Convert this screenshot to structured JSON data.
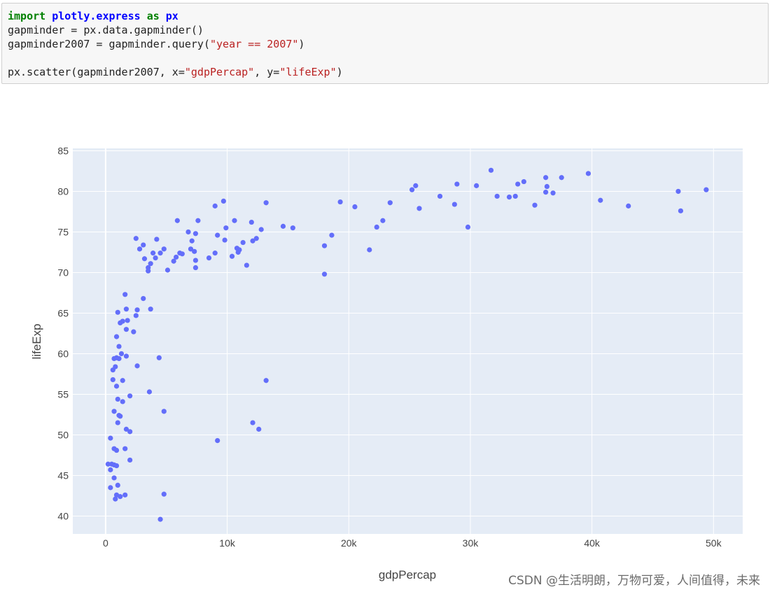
{
  "code_cell": {
    "lines": [
      [
        {
          "t": "import",
          "c": "kw"
        },
        {
          "t": " ",
          "c": ""
        },
        {
          "t": "plotly.express",
          "c": "mod"
        },
        {
          "t": " ",
          "c": ""
        },
        {
          "t": "as",
          "c": "kw"
        },
        {
          "t": " ",
          "c": ""
        },
        {
          "t": "px",
          "c": "mod"
        }
      ],
      [
        {
          "t": "gapminder = px.data.gapminder()",
          "c": ""
        }
      ],
      [
        {
          "t": "gapminder2007 = gapminder.query(",
          "c": ""
        },
        {
          "t": "\"year == 2007\"",
          "c": "str"
        },
        {
          "t": ")",
          "c": ""
        }
      ],
      [],
      [
        {
          "t": "px.scatter(gapminder2007, x=",
          "c": ""
        },
        {
          "t": "\"gdpPercap\"",
          "c": "str"
        },
        {
          "t": ", y=",
          "c": ""
        },
        {
          "t": "\"lifeExp\"",
          "c": "str"
        },
        {
          "t": ")",
          "c": ""
        }
      ]
    ]
  },
  "chart_data": {
    "type": "scatter",
    "title": "",
    "xlabel": "gdpPercap",
    "ylabel": "lifeExp",
    "xlim": [
      -2700,
      52400
    ],
    "ylim": [
      37.8,
      85.3
    ],
    "x_ticks": [
      0,
      10000,
      20000,
      30000,
      40000,
      50000
    ],
    "x_tick_labels": [
      "0",
      "10k",
      "20k",
      "30k",
      "40k",
      "50k"
    ],
    "y_ticks": [
      40,
      45,
      50,
      55,
      60,
      65,
      70,
      75,
      80,
      85
    ],
    "y_tick_labels": [
      "40",
      "45",
      "50",
      "55",
      "60",
      "65",
      "70",
      "75",
      "80",
      "85"
    ],
    "grid": true,
    "background": "#e5ecf6",
    "marker_color": "#636efa",
    "points": [
      [
        31700,
        82.6
      ],
      [
        39700,
        82.2
      ],
      [
        36200,
        81.7
      ],
      [
        37500,
        81.7
      ],
      [
        34400,
        81.2
      ],
      [
        28900,
        80.9
      ],
      [
        30500,
        80.7
      ],
      [
        36300,
        80.6
      ],
      [
        25500,
        80.7
      ],
      [
        33900,
        80.9
      ],
      [
        25200,
        80.2
      ],
      [
        36200,
        79.9
      ],
      [
        36800,
        79.8
      ],
      [
        27500,
        79.4
      ],
      [
        32200,
        79.4
      ],
      [
        33200,
        79.3
      ],
      [
        33700,
        79.4
      ],
      [
        47100,
        80.0
      ],
      [
        49400,
        80.2
      ],
      [
        40700,
        78.9
      ],
      [
        35300,
        78.3
      ],
      [
        43000,
        78.2
      ],
      [
        28700,
        78.4
      ],
      [
        25800,
        77.9
      ],
      [
        47300,
        77.6
      ],
      [
        19300,
        78.7
      ],
      [
        20500,
        78.1
      ],
      [
        23400,
        78.6
      ],
      [
        29800,
        75.6
      ],
      [
        22800,
        76.4
      ],
      [
        22300,
        75.6
      ],
      [
        14600,
        75.7
      ],
      [
        15400,
        75.5
      ],
      [
        18600,
        74.6
      ],
      [
        18000,
        73.3
      ],
      [
        21700,
        72.8
      ],
      [
        18000,
        69.8
      ],
      [
        13200,
        78.6
      ],
      [
        9700,
        78.8
      ],
      [
        9000,
        78.2
      ],
      [
        10600,
        76.4
      ],
      [
        12000,
        76.2
      ],
      [
        7600,
        76.4
      ],
      [
        5900,
        76.4
      ],
      [
        9900,
        75.5
      ],
      [
        12800,
        75.3
      ],
      [
        6800,
        75.0
      ],
      [
        7400,
        74.8
      ],
      [
        9200,
        74.6
      ],
      [
        9800,
        74.0
      ],
      [
        7100,
        73.9
      ],
      [
        12100,
        73.9
      ],
      [
        12400,
        74.2
      ],
      [
        11300,
        73.7
      ],
      [
        10800,
        73.0
      ],
      [
        11000,
        72.8
      ],
      [
        10900,
        72.5
      ],
      [
        7000,
        72.9
      ],
      [
        7300,
        72.6
      ],
      [
        6100,
        72.4
      ],
      [
        6300,
        72.3
      ],
      [
        5800,
        71.9
      ],
      [
        8500,
        71.8
      ],
      [
        10400,
        72.0
      ],
      [
        9000,
        72.4
      ],
      [
        5600,
        71.4
      ],
      [
        7400,
        71.5
      ],
      [
        7400,
        70.6
      ],
      [
        11600,
        70.9
      ],
      [
        5100,
        70.3
      ],
      [
        4800,
        72.9
      ],
      [
        4500,
        72.4
      ],
      [
        3900,
        72.4
      ],
      [
        4100,
        71.8
      ],
      [
        3700,
        71.1
      ],
      [
        3200,
        71.7
      ],
      [
        3500,
        70.6
      ],
      [
        3500,
        70.2
      ],
      [
        2500,
        74.2
      ],
      [
        4200,
        74.1
      ],
      [
        2800,
        72.9
      ],
      [
        3100,
        73.4
      ],
      [
        3100,
        66.8
      ],
      [
        3700,
        65.5
      ],
      [
        2600,
        65.4
      ],
      [
        1600,
        67.3
      ],
      [
        1700,
        65.5
      ],
      [
        2500,
        64.7
      ],
      [
        1000,
        65.1
      ],
      [
        1800,
        64.1
      ],
      [
        1200,
        63.8
      ],
      [
        1400,
        64.0
      ],
      [
        1700,
        63.0
      ],
      [
        2300,
        62.7
      ],
      [
        900,
        62.1
      ],
      [
        1100,
        60.9
      ],
      [
        1300,
        60.0
      ],
      [
        1700,
        59.7
      ],
      [
        700,
        59.4
      ],
      [
        900,
        59.5
      ],
      [
        1100,
        59.4
      ],
      [
        4400,
        59.5
      ],
      [
        2600,
        58.5
      ],
      [
        800,
        58.4
      ],
      [
        600,
        58.0
      ],
      [
        600,
        56.8
      ],
      [
        1400,
        56.7
      ],
      [
        900,
        56.0
      ],
      [
        3600,
        55.3
      ],
      [
        2000,
        54.8
      ],
      [
        1000,
        54.4
      ],
      [
        1400,
        54.1
      ],
      [
        13200,
        56.7
      ],
      [
        700,
        52.9
      ],
      [
        1100,
        52.4
      ],
      [
        1200,
        52.3
      ],
      [
        4800,
        52.9
      ],
      [
        1000,
        51.5
      ],
      [
        12100,
        51.5
      ],
      [
        12600,
        50.7
      ],
      [
        1700,
        50.7
      ],
      [
        2000,
        50.4
      ],
      [
        400,
        49.6
      ],
      [
        9200,
        49.3
      ],
      [
        700,
        48.3
      ],
      [
        900,
        48.1
      ],
      [
        1600,
        48.3
      ],
      [
        2000,
        46.9
      ],
      [
        200,
        46.4
      ],
      [
        500,
        46.4
      ],
      [
        700,
        46.3
      ],
      [
        900,
        46.2
      ],
      [
        400,
        45.7
      ],
      [
        700,
        44.7
      ],
      [
        1000,
        43.8
      ],
      [
        400,
        43.5
      ],
      [
        800,
        42.1
      ],
      [
        900,
        42.6
      ],
      [
        1200,
        42.4
      ],
      [
        1600,
        42.6
      ],
      [
        4800,
        42.7
      ],
      [
        4500,
        39.6
      ]
    ]
  },
  "watermark": "CSDN @生活明朗，万物可爱，人间值得，未来"
}
